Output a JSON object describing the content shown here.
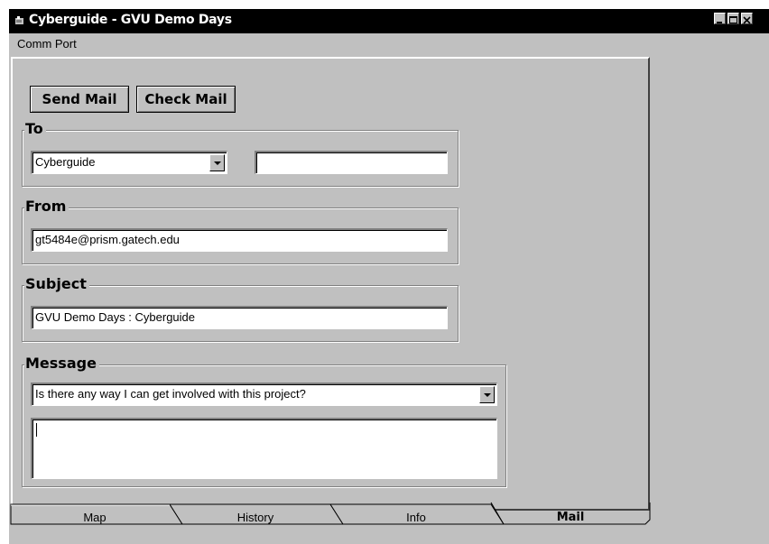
{
  "window": {
    "title": "Cyberguide - GVU Demo Days"
  },
  "menu": {
    "items": [
      "Comm Port"
    ]
  },
  "toolbar": {
    "send_label": "Send Mail",
    "check_label": "Check Mail"
  },
  "to": {
    "label": "To",
    "select_value": "Cyberguide",
    "address_value": ""
  },
  "from": {
    "label": "From",
    "value": "gt5484e@prism.gatech.edu"
  },
  "subject": {
    "label": "Subject",
    "value": "GVU Demo Days : Cyberguide"
  },
  "message": {
    "label": "Message",
    "select_value": "Is there any way I can get involved with this project?",
    "body_value": ""
  },
  "tabs": [
    {
      "label": "Map",
      "active": false
    },
    {
      "label": "History",
      "active": false
    },
    {
      "label": "Info",
      "active": false
    },
    {
      "label": "Mail",
      "active": true
    }
  ],
  "icons": {
    "app": "app-icon",
    "minimize": "minimize-icon",
    "maximize": "maximize-icon",
    "close": "close-icon",
    "dropdown": "chevron-down-icon"
  }
}
